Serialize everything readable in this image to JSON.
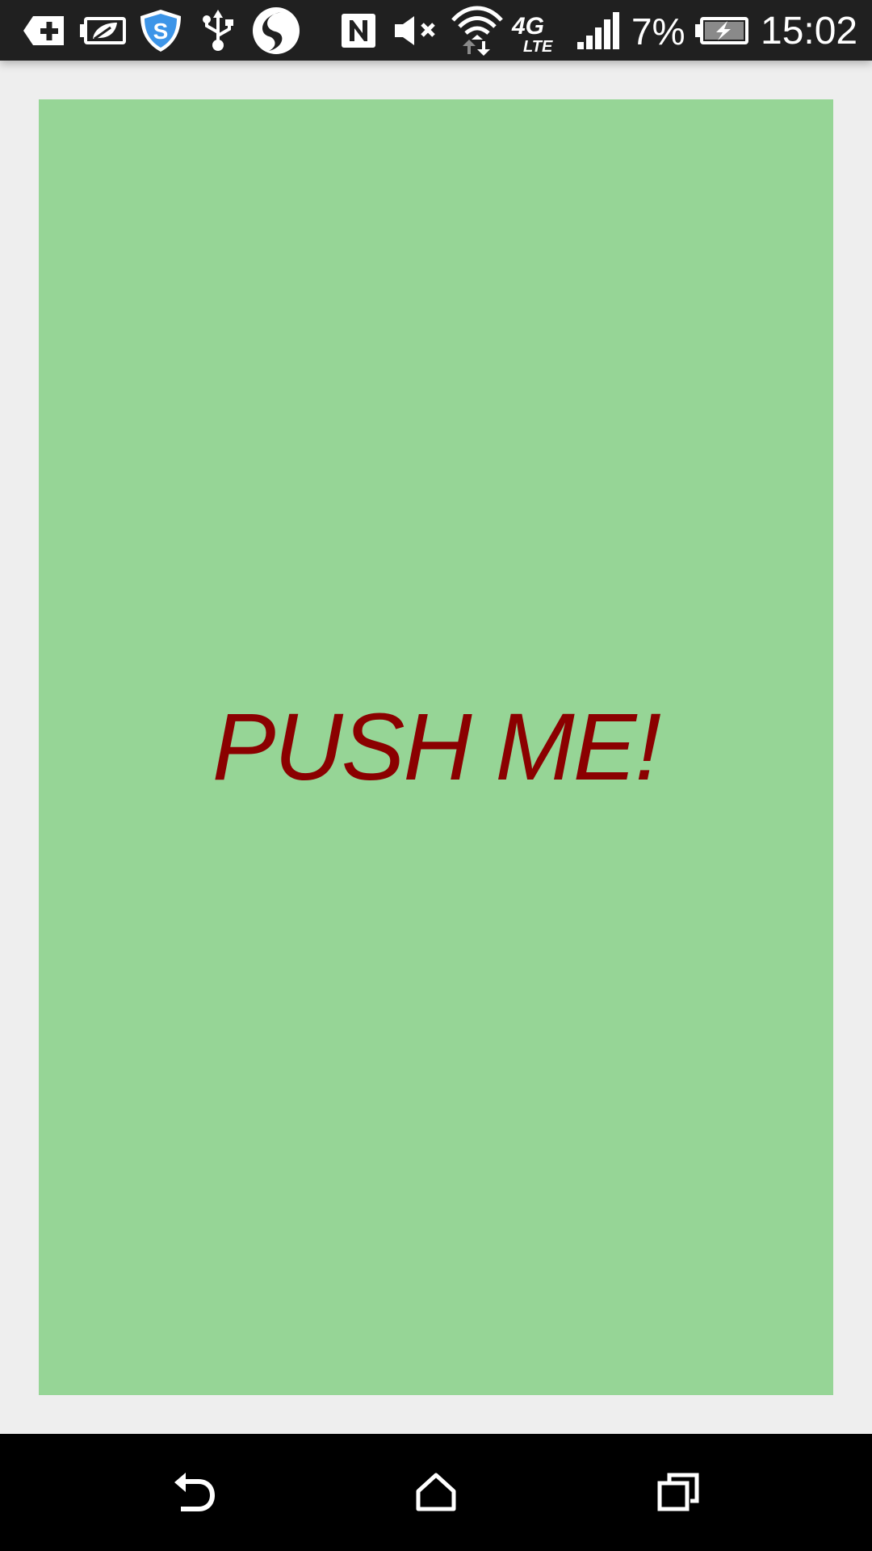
{
  "status_bar": {
    "battery_percent": "7%",
    "time": "15:02",
    "network_label": "4G",
    "network_sub_label": "LTE",
    "icons": [
      "add-notification-icon",
      "battery-saver-icon",
      "shield-icon",
      "usb-icon",
      "swype-icon",
      "nfc-icon",
      "mute-icon",
      "wifi-icon",
      "network-4g-lte-icon",
      "signal-icon",
      "battery-charging-icon"
    ],
    "bar_color": "#202020",
    "shield_color": "#3d95e8"
  },
  "main": {
    "button_label": "PUSH ME!",
    "button_background": "#96d596",
    "button_text_color": "#8b0000",
    "page_background": "#eeeeee"
  },
  "nav_bar": {
    "icons": [
      "back-icon",
      "home-icon",
      "recents-icon"
    ],
    "bar_color": "#000000"
  }
}
